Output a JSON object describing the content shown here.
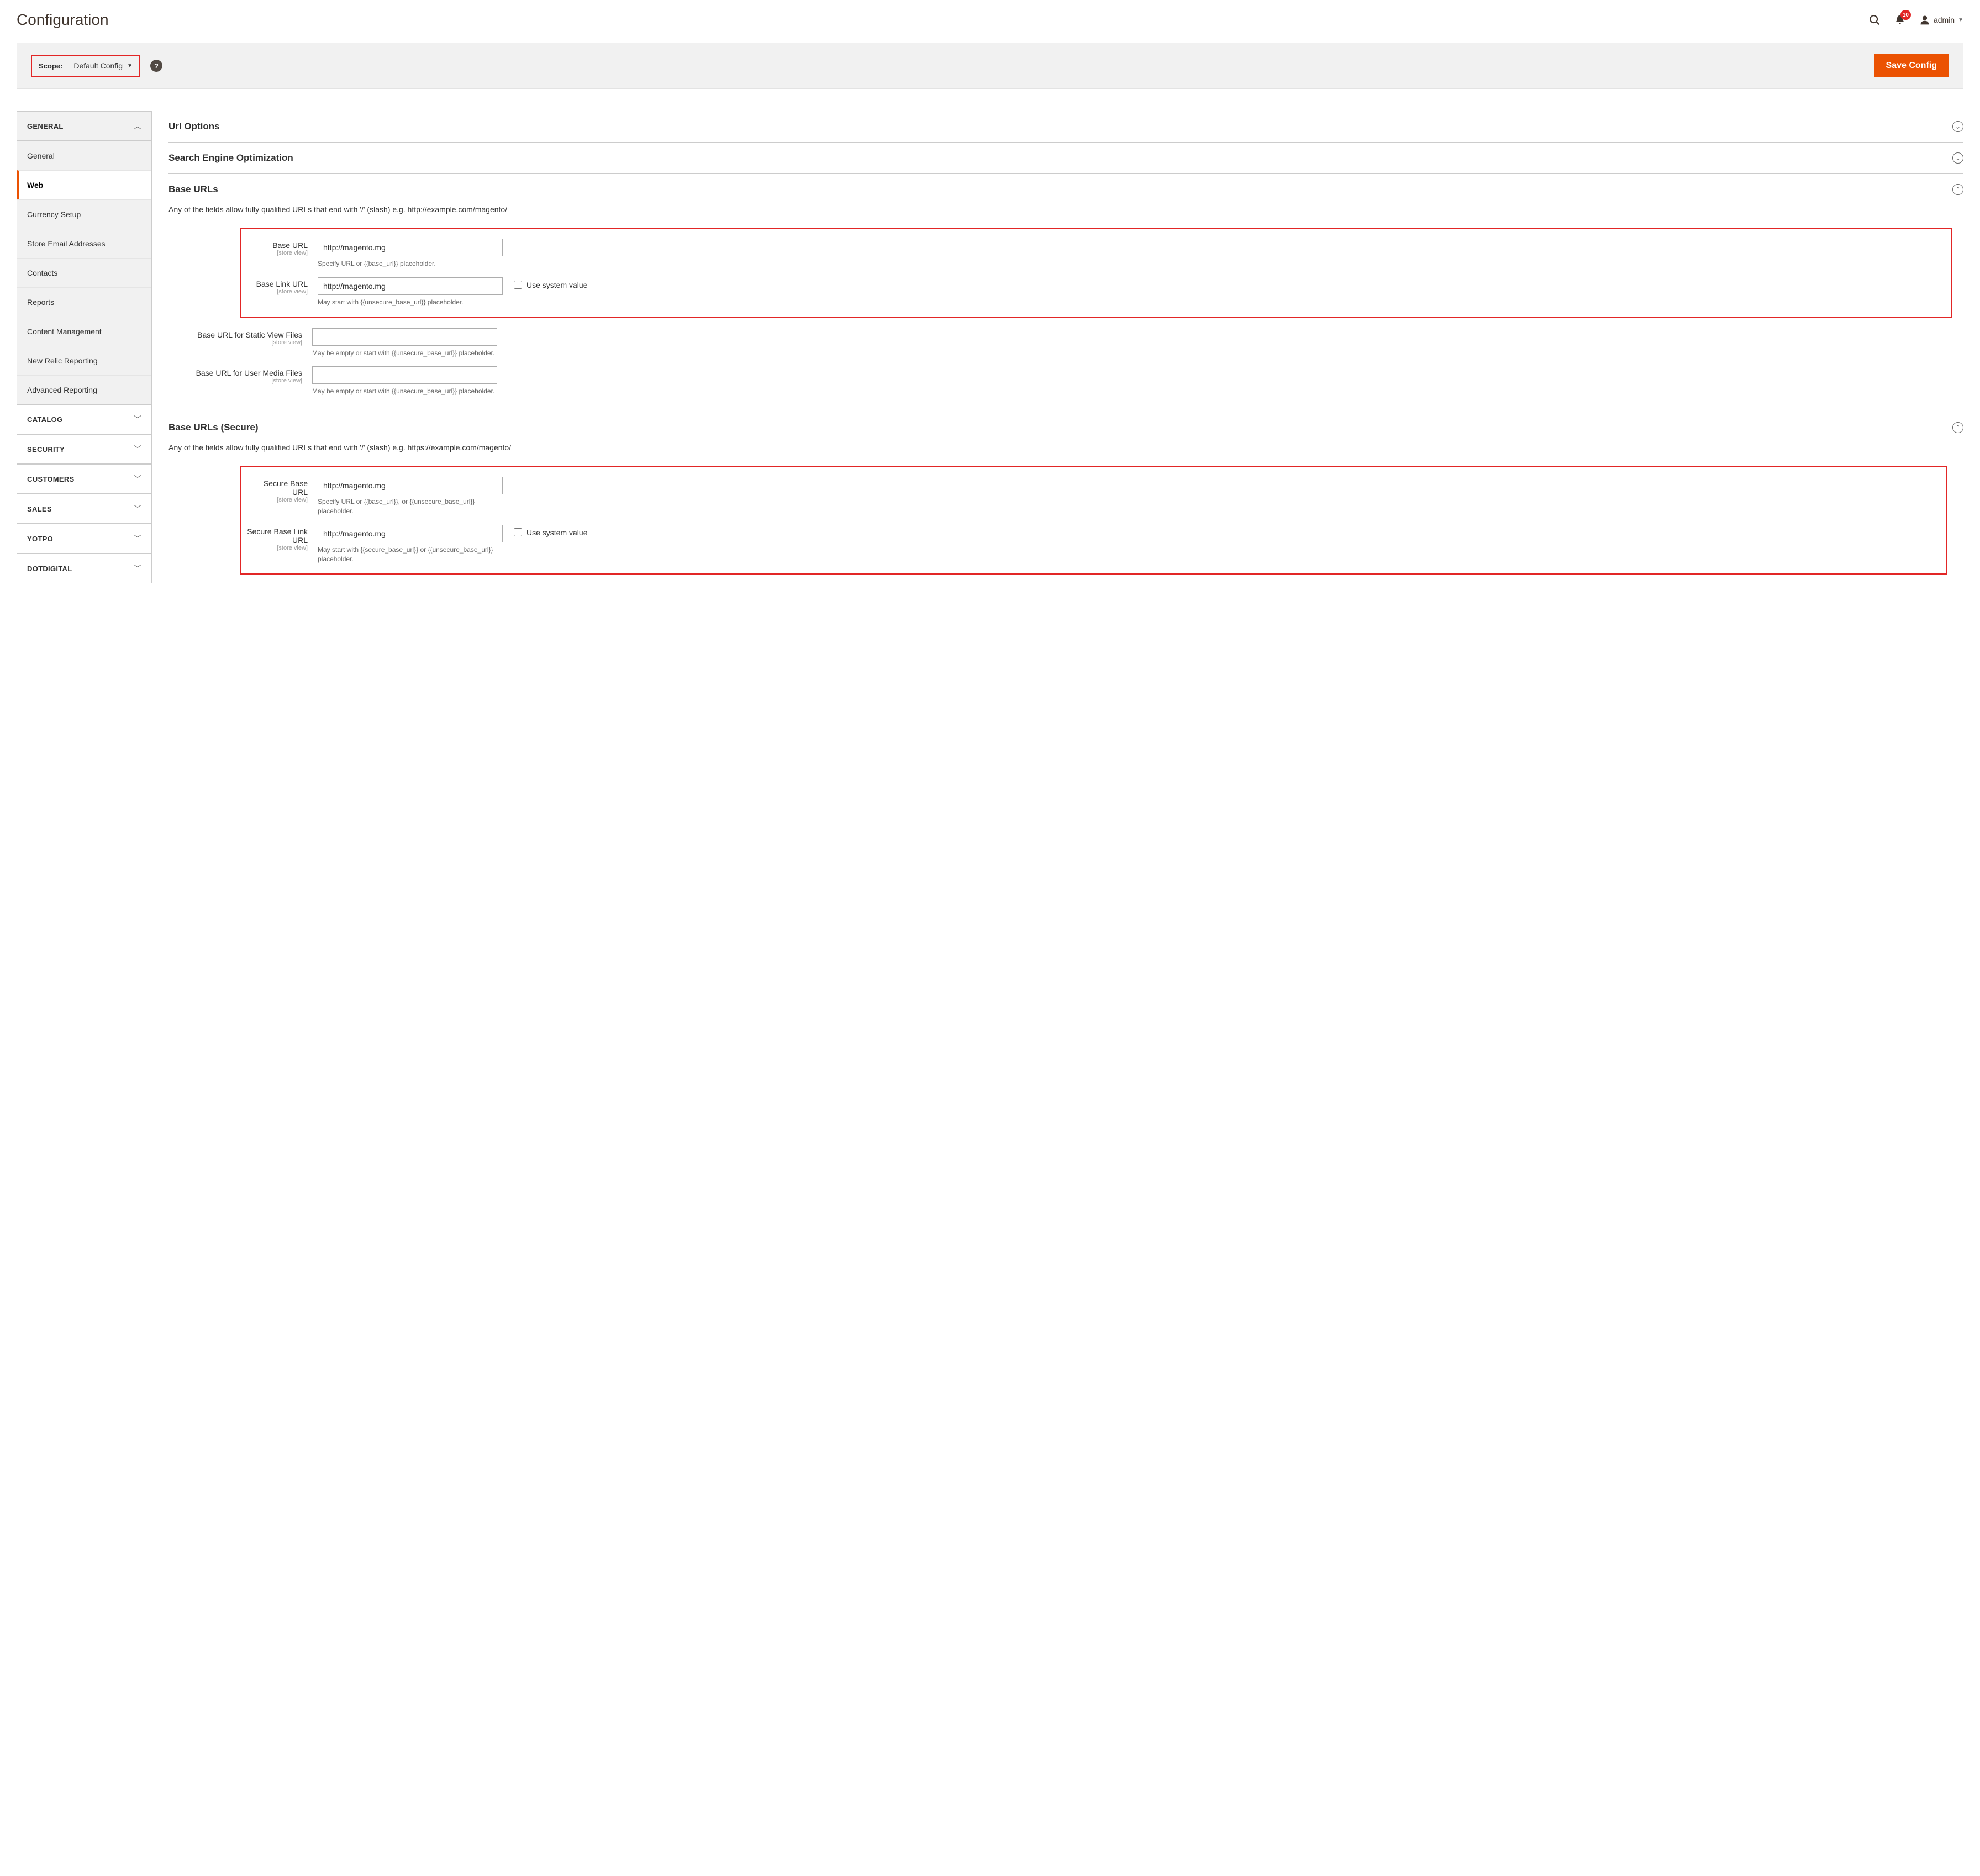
{
  "header": {
    "title": "Configuration",
    "notif_count": "10",
    "username": "admin"
  },
  "scope": {
    "label": "Scope:",
    "value": "Default Config",
    "save_btn": "Save Config"
  },
  "sidebar": {
    "open_section": "GENERAL",
    "items": [
      "General",
      "Web",
      "Currency Setup",
      "Store Email Addresses",
      "Contacts",
      "Reports",
      "Content Management",
      "New Relic Reporting",
      "Advanced Reporting"
    ],
    "collapsed": [
      "CATALOG",
      "SECURITY",
      "CUSTOMERS",
      "SALES",
      "YOTPO",
      "DOTDIGITAL"
    ]
  },
  "panels": {
    "url_options": "Url Options",
    "seo": "Search Engine Optimization",
    "base_urls": {
      "title": "Base URLs",
      "note": "Any of the fields allow fully qualified URLs that end with '/' (slash) e.g. http://example.com/magento/",
      "base_url": {
        "label": "Base URL",
        "scope": "[store view]",
        "value": "http://magento.mg",
        "hint": "Specify URL or {{base_url}} placeholder."
      },
      "base_link_url": {
        "label": "Base Link URL",
        "scope": "[store view]",
        "value": "http://magento.mg",
        "hint": "May start with {{unsecure_base_url}} placeholder.",
        "sys": "Use system value"
      },
      "static": {
        "label": "Base URL for Static View Files",
        "scope": "[store view]",
        "value": "",
        "hint": "May be empty or start with {{unsecure_base_url}} placeholder."
      },
      "media": {
        "label": "Base URL for User Media Files",
        "scope": "[store view]",
        "value": "",
        "hint": "May be empty or start with {{unsecure_base_url}} placeholder."
      }
    },
    "base_urls_secure": {
      "title": "Base URLs (Secure)",
      "note": "Any of the fields allow fully qualified URLs that end with '/' (slash) e.g. https://example.com/magento/",
      "secure_base_url": {
        "label": "Secure Base URL",
        "scope": "[store view]",
        "value": "http://magento.mg",
        "hint": "Specify URL or {{base_url}}, or {{unsecure_base_url}} placeholder."
      },
      "secure_base_link_url": {
        "label": "Secure Base Link URL",
        "scope": "[store view]",
        "value": "http://magento.mg",
        "hint": "May start with {{secure_base_url}} or {{unsecure_base_url}} placeholder.",
        "sys": "Use system value"
      }
    }
  }
}
